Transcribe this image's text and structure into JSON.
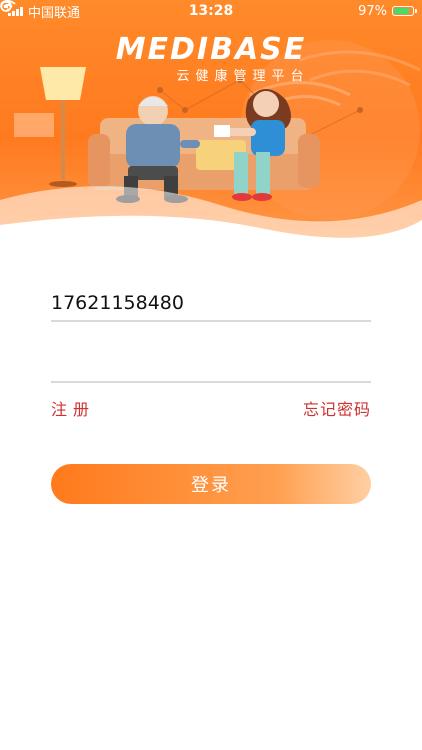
{
  "status_bar": {
    "carrier": "中国联通",
    "time": "13:28",
    "battery": "97%"
  },
  "logo": {
    "brand": "MEDIBASE",
    "tagline": "云健康管理平台"
  },
  "form": {
    "phone_value": "17621158480",
    "password_value": ""
  },
  "links": {
    "register": "注册",
    "forgot_password": "忘记密码"
  },
  "login_button": "登录",
  "colors": {
    "accent_orange": "#ff7a1f",
    "link_red": "#d0302f"
  }
}
